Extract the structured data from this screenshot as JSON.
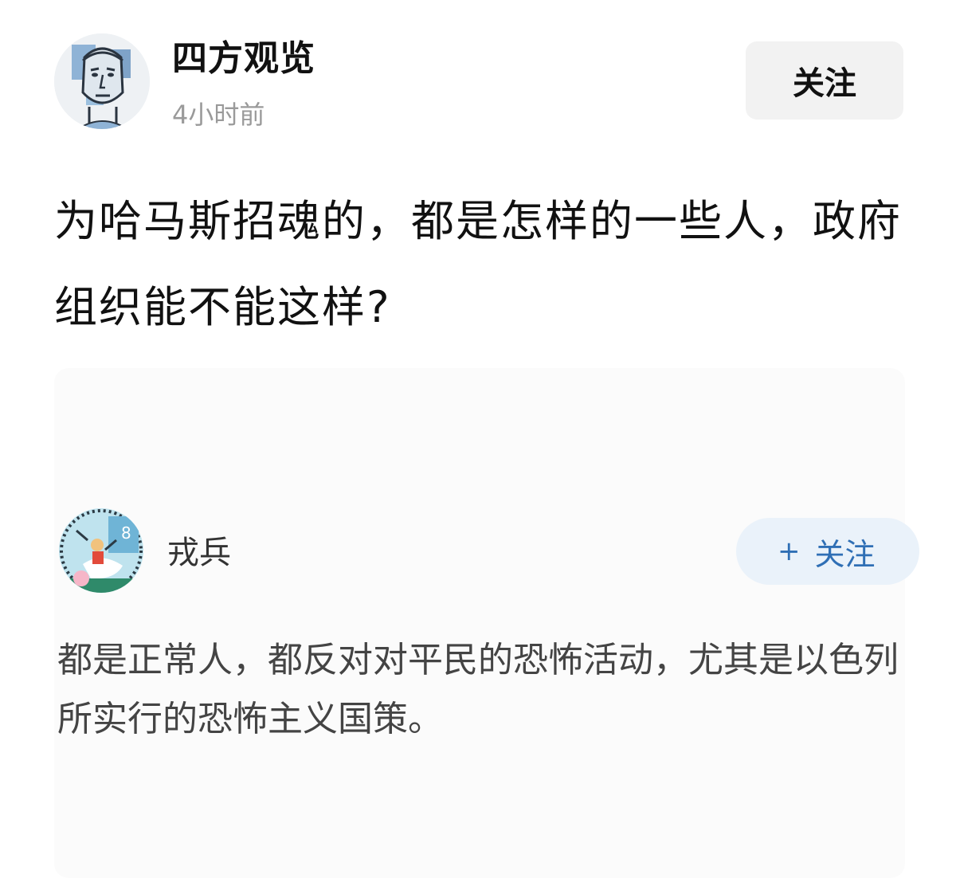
{
  "post": {
    "author_name": "四方观览",
    "time": "4小时前",
    "follow_label": "关注",
    "title": "为哈马斯招魂的，都是怎样的一些人，政府组织能不能这样?"
  },
  "answer": {
    "author_name": "戎兵",
    "follow_plus": "+",
    "follow_label": "关注",
    "text": "都是正常人，都反对对平民的恐怖活动，尤其是以色列所实行的恐怖主义国策。"
  },
  "icons": {
    "author_avatar": "illustrated-face-avatar",
    "answer_avatar": "stamp-illustration-avatar"
  },
  "colors": {
    "follow_accent": "#2f6fb5",
    "follow_pill_bg": "#eaf2fa",
    "muted_text": "#9a9a9a"
  }
}
